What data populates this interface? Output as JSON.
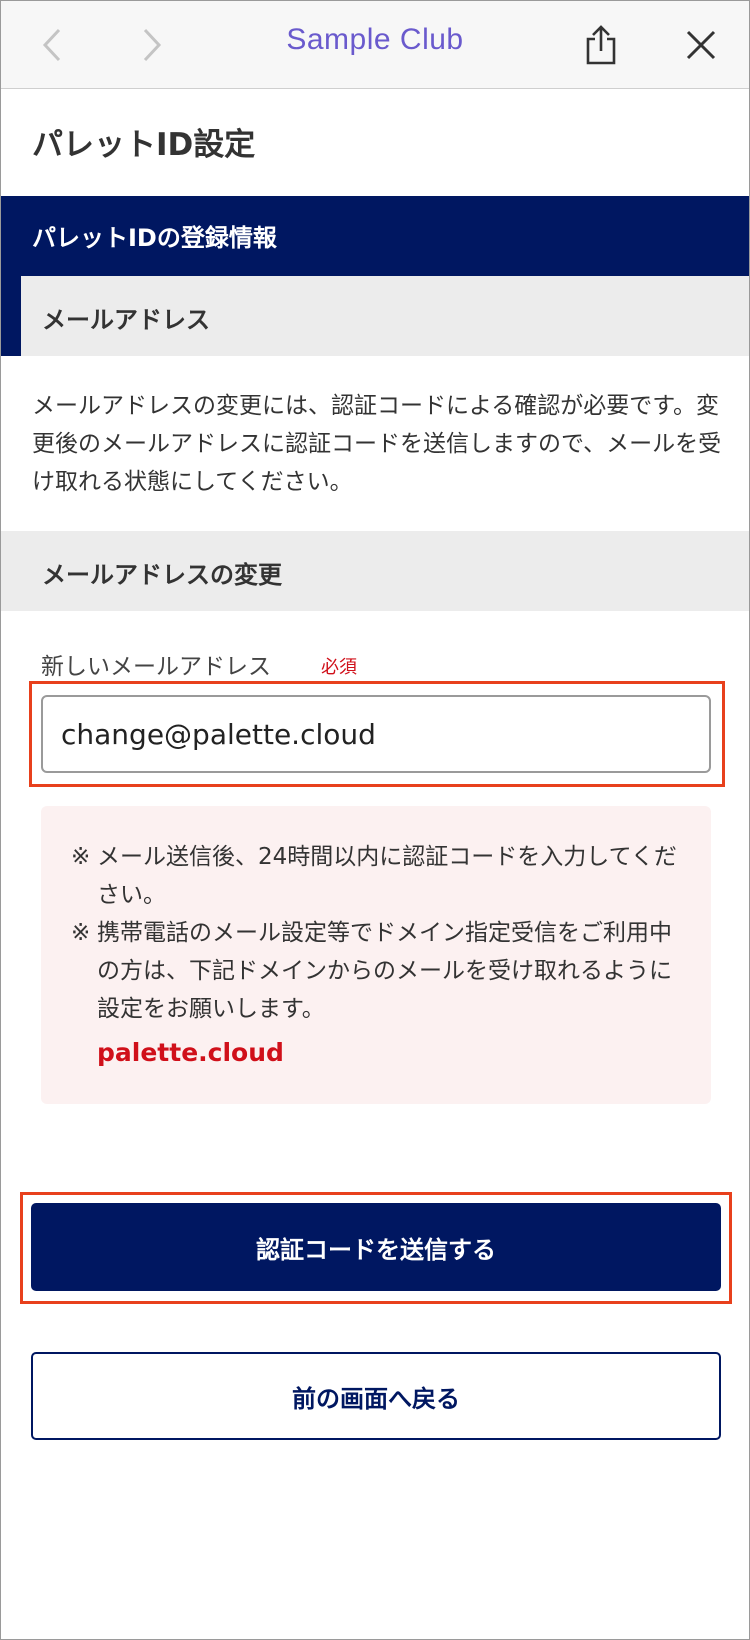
{
  "browser": {
    "title": "Sample Club",
    "back_icon": "chevron-left-icon",
    "forward_icon": "chevron-right-icon",
    "share_icon": "share-icon",
    "close_icon": "close-icon"
  },
  "page": {
    "title": "パレットID設定"
  },
  "section": {
    "title": "パレットIDの登録情報",
    "email_header": "メールアドレス",
    "description": "メールアドレスの変更には、認証コードによる確認が必要です。変更後のメールアドレスに認証コードを送信しますので、メールを受け取れる状態にしてください。",
    "change_header": "メールアドレスの変更"
  },
  "form": {
    "label": "新しいメールアドレス",
    "required": "必須",
    "value": "change@palette.cloud"
  },
  "notice": {
    "mark": "※",
    "line1": "メール送信後、24時間以内に認証コードを入力してください。",
    "line2": "携帯電話のメール設定等でドメイン指定受信をご利用中の方は、下記ドメインからのメールを受け取れるように設定をお願いします。",
    "domain": "palette.cloud"
  },
  "buttons": {
    "send_code": "認証コードを送信する",
    "back": "前の画面へ戻る"
  },
  "colors": {
    "navy": "#001761",
    "highlight": "#e8401c",
    "required_red": "#d0101a",
    "brand_purple": "#6a5acd"
  }
}
